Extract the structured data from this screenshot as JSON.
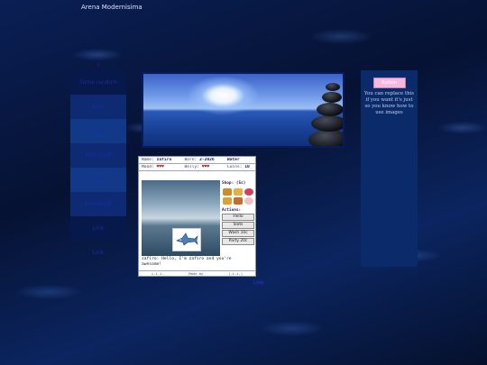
{
  "site": {
    "title": "Arena Modernisima"
  },
  "nav": {
    "items": [
      {
        "label": "?"
      },
      {
        "label": "Some random"
      },
      {
        "label": "Link"
      },
      {
        "label": "Link"
      },
      {
        "label": "Pets Stuff"
      },
      {
        "label": "Link"
      },
      {
        "label": "Pets Stuff"
      },
      {
        "label": "Link"
      },
      {
        "label": "Link"
      }
    ]
  },
  "pet": {
    "name_label": "Name:",
    "name": "zafiro",
    "born_label": "Born:",
    "born": "2-2026",
    "type": "Water",
    "mood_label": "Mood:",
    "mood": "♥♥♥",
    "belly_label": "Belly:",
    "belly": "♥♥♥",
    "coins_label": "Coins:",
    "coins": "10",
    "shop_title": "Shop: (5c)",
    "actions_title": "Actions:",
    "actions": [
      "Hello",
      "Slots",
      "Wash 10c",
      "Party 20c"
    ],
    "chat": "zafiro: Hello, I'm zafiro and you're awesome!",
    "footer": [
      "i.i.i.",
      "Made by",
      "(.i.i.)"
    ]
  },
  "right_panel": {
    "button_label": "Button",
    "text": "You can replace this if you want it's just so you know how to use images"
  },
  "footer": {
    "link": "Link"
  },
  "colors": {
    "nav_text": "#1c2aa8",
    "panel_bg": "#0a2a6a",
    "accent_pink": "#f6b8e0"
  }
}
